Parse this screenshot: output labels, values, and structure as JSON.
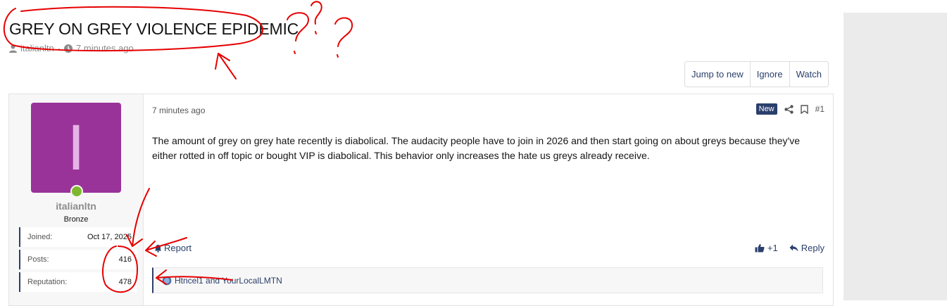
{
  "thread": {
    "title": "GREY ON GREY VIOLENCE EPIDEMIC",
    "author": "italianltn",
    "separator": "·",
    "time": "7 minutes ago"
  },
  "thread_buttons": {
    "jump": "Jump to new",
    "ignore": "Ignore",
    "watch": "Watch"
  },
  "post": {
    "user": {
      "avatar_letter": "I",
      "avatar_color": "#993399",
      "name": "italianltn",
      "title": "Bronze",
      "stats": [
        {
          "label": "Joined:",
          "value": "Oct 17, 2025"
        },
        {
          "label": "Posts:",
          "value": "416"
        },
        {
          "label": "Reputation:",
          "value": "478"
        }
      ]
    },
    "date": "7 minutes ago",
    "new_badge": "New",
    "number": "#1",
    "body": "The amount of grey on grey hate recently is diabolical. The audacity people have to join in 2026 and then start going on about greys because they've either rotted in off topic or bought VIP is diabolical. This behavior only increases the hate us greys already receive.",
    "report": "Report",
    "plus_one": "+1",
    "reply": "Reply",
    "reactions": "Htncel1 and YourLocalLMTN"
  },
  "annotation_color": "#e60000"
}
